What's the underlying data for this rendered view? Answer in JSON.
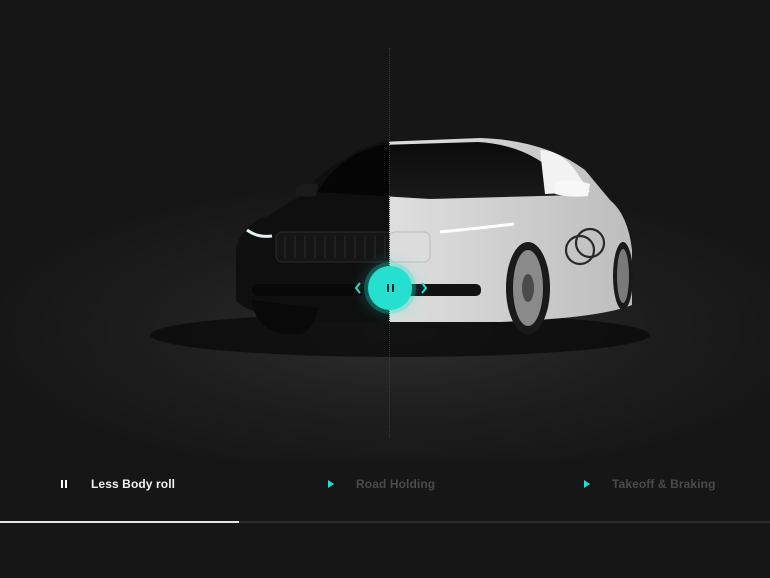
{
  "compare": {
    "handle_icon": "pause-icon",
    "prev_icon": "chevron-left-icon",
    "next_icon": "chevron-right-icon"
  },
  "tabs": [
    {
      "label": "Less Body roll",
      "icon": "pause-icon",
      "state": "active"
    },
    {
      "label": "Road Holding",
      "icon": "play-icon",
      "state": "inactive"
    },
    {
      "label": "Takeoff & Braking",
      "icon": "play-icon",
      "state": "inactive"
    }
  ],
  "progress": {
    "value": 0.31
  },
  "colors": {
    "accent": "#25e0cf",
    "background": "#161616",
    "active_text": "#f2f2f2",
    "inactive_text": "#4a4a4a",
    "car_dark": "#0e0e0e",
    "car_light": "#e9e9e9"
  }
}
